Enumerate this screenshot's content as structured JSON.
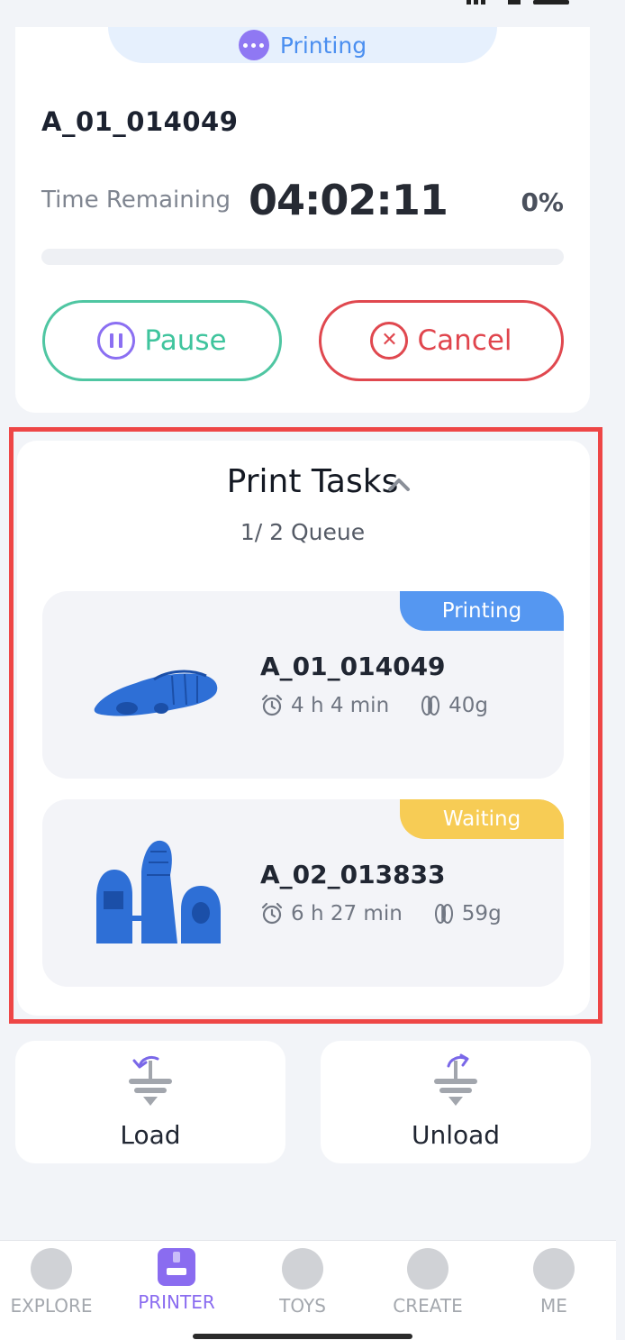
{
  "status": {
    "label": "Printing"
  },
  "job": {
    "file_name": "A_01_014049",
    "time_label": "Time Remaining",
    "time_value": "04:02:11",
    "percent": "0%",
    "progress_fraction": 0
  },
  "actions": {
    "pause_label": "Pause",
    "cancel_label": "Cancel"
  },
  "tasks": {
    "title": "Print Tasks",
    "queue": "1/ 2 Queue",
    "items": [
      {
        "status": "Printing",
        "name": "A_01_014049",
        "duration": "4 h 4 min",
        "weight": "40g"
      },
      {
        "status": "Waiting",
        "name": "A_02_013833",
        "duration": "6 h 27 min",
        "weight": "59g"
      }
    ]
  },
  "filament": {
    "load_label": "Load",
    "unload_label": "Unload"
  },
  "nav": {
    "items": [
      {
        "label": "EXPLORE"
      },
      {
        "label": "PRINTER"
      },
      {
        "label": "TOYS"
      },
      {
        "label": "CREATE"
      },
      {
        "label": "ME"
      }
    ]
  },
  "colors": {
    "accent": "#8a6cf0",
    "pause": "#3fc49d",
    "cancel": "#e0454d",
    "printing_badge": "#5597f1",
    "waiting_badge": "#f7cc55",
    "highlight": "#ee4646"
  }
}
